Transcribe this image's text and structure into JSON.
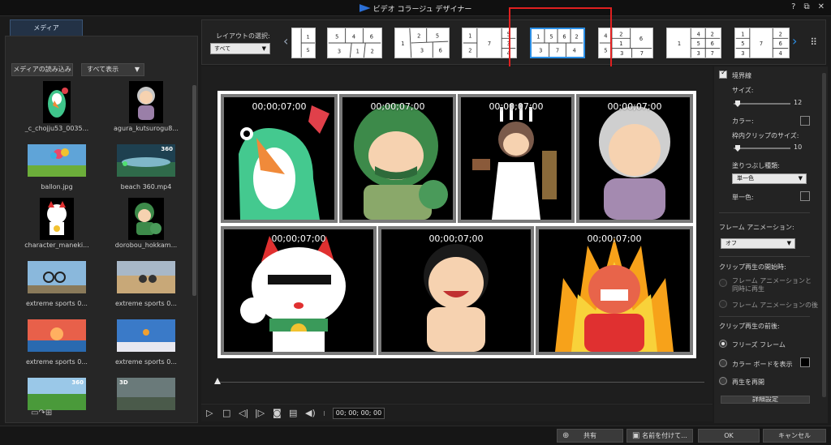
{
  "window": {
    "title": "ビデオ コラージュ デザイナー",
    "help": "?",
    "restore": "⧉",
    "close": "✕"
  },
  "media_panel": {
    "tab": "メディア",
    "import_button": "メディアの読み込み",
    "filter_value": "すべて表示",
    "items": [
      {
        "label": "_c_chojju53_0035...",
        "icon": "frog-icon"
      },
      {
        "label": "agura_kutsurogu8...",
        "icon": "grandma-icon"
      },
      {
        "label": "ballon.jpg",
        "icon": "balloon-photo-icon"
      },
      {
        "label": "beach 360.mp4",
        "icon": "beach-photo-icon",
        "badge": "360"
      },
      {
        "label": "character_maneki...",
        "icon": "maneki-icon"
      },
      {
        "label": "dorobou_hokkam...",
        "icon": "thief-icon"
      },
      {
        "label": "extreme sports 0...",
        "icon": "bike-photo-icon"
      },
      {
        "label": "extreme sports 0...",
        "icon": "moto-photo-icon"
      },
      {
        "label": "extreme sports 0...",
        "icon": "sunset-photo-icon"
      },
      {
        "label": "extreme sports 0...",
        "icon": "skydive-photo-icon"
      },
      {
        "label": "",
        "icon": "field-photo-icon",
        "badge": "360"
      },
      {
        "label": "",
        "icon": "bikes-photo-icon",
        "badge": "3D"
      }
    ]
  },
  "layout_bar": {
    "label": "レイアウトの選択:",
    "select_value": "すべて",
    "thumbs": [
      {
        "cells": [
          "1",
          "5"
        ]
      },
      {
        "cells": [
          "5",
          "4",
          "6",
          "3",
          "1",
          "2"
        ]
      },
      {
        "cells": [
          "1",
          "2",
          "5",
          "3",
          "6"
        ]
      },
      {
        "cells": [
          "1",
          "2",
          "7",
          "5",
          "3",
          "4"
        ]
      },
      {
        "cells": [
          "1",
          "5",
          "6",
          "2",
          "3",
          "7",
          "4"
        ],
        "selected": true
      },
      {
        "cells": [
          "4",
          "2",
          "1",
          "6",
          "5",
          "3",
          "7"
        ]
      },
      {
        "cells": [
          "1",
          "4",
          "5",
          "6",
          "2",
          "3",
          "7"
        ]
      },
      {
        "cells": [
          "1",
          "2",
          "6",
          "7",
          "5",
          "3",
          "4"
        ]
      }
    ]
  },
  "preview": {
    "timecodes": [
      "00;00;07;00",
      "00;00;07;00",
      "00;00;07;00",
      "00;00;07;00",
      "00;00;07;00",
      "00;00;07;00",
      "00;00;07;00"
    ],
    "playback_timecode": "00; 00; 00; 00"
  },
  "properties": {
    "border_label": "境界線",
    "size_label": "サイズ:",
    "size_value": "12",
    "color_label": "カラー:",
    "color_value": "#7a7a7a",
    "inner_clip_size_label": "枠内クリップのサイズ:",
    "inner_clip_size_value": "10",
    "fill_type_label": "塗りつぶし種類:",
    "fill_type_value": "単一色",
    "single_color_label": "単一色:",
    "single_color_value": "#ffffff",
    "frame_animation_label": "フレーム アニメーション:",
    "frame_animation_value": "オフ",
    "clip_start_label": "クリップ再生の開始時:",
    "clip_start_option1": "フレーム アニメーションと同時に再生",
    "clip_start_option2": "フレーム アニメーションの後",
    "clip_after_label": "クリップ再生の前後:",
    "after_option1": "フリーズ フレーム",
    "after_option2": "カラー ボードを表示",
    "after_option2_color": "#000000",
    "after_option3": "再生を再開",
    "advanced_button": "詳細設定"
  },
  "bottom_bar": {
    "share": "共有",
    "save_as": "名前を付けて...",
    "ok": "OK",
    "cancel": "キャンセル"
  }
}
